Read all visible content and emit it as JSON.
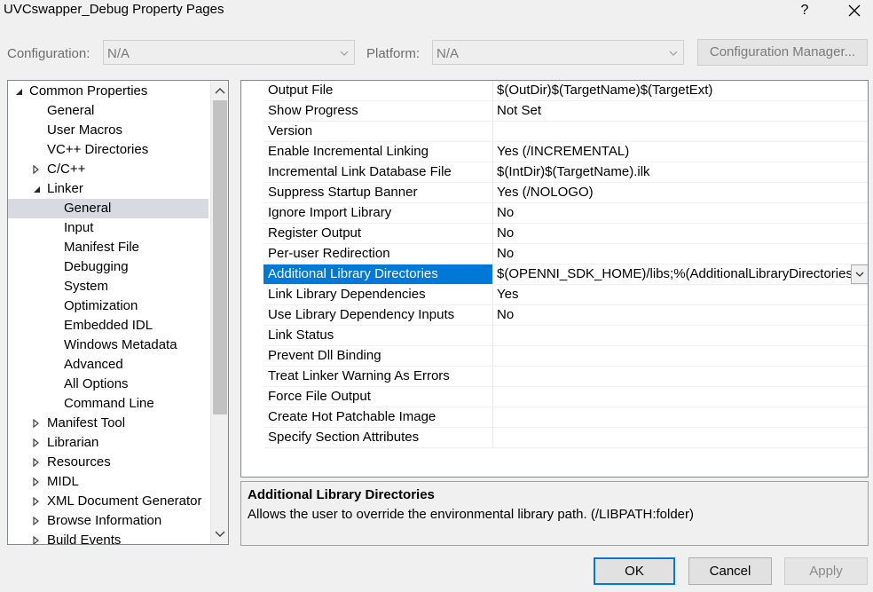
{
  "window": {
    "title": "UVCswapper_Debug Property Pages",
    "help_glyph": "?"
  },
  "config": {
    "configuration_label": "Configuration:",
    "configuration_value": "N/A",
    "platform_label": "Platform:",
    "platform_value": "N/A",
    "manager_button": "Configuration Manager..."
  },
  "tree": {
    "items": [
      {
        "label": "Common Properties"
      },
      {
        "label": "General"
      },
      {
        "label": "User Macros"
      },
      {
        "label": "VC++ Directories"
      },
      {
        "label": "C/C++"
      },
      {
        "label": "Linker"
      },
      {
        "label": "General"
      },
      {
        "label": "Input"
      },
      {
        "label": "Manifest File"
      },
      {
        "label": "Debugging"
      },
      {
        "label": "System"
      },
      {
        "label": "Optimization"
      },
      {
        "label": "Embedded IDL"
      },
      {
        "label": "Windows Metadata"
      },
      {
        "label": "Advanced"
      },
      {
        "label": "All Options"
      },
      {
        "label": "Command Line"
      },
      {
        "label": "Manifest Tool"
      },
      {
        "label": "Librarian"
      },
      {
        "label": "Resources"
      },
      {
        "label": "MIDL"
      },
      {
        "label": "XML Document Generator"
      },
      {
        "label": "Browse Information"
      },
      {
        "label": "Build Events"
      }
    ]
  },
  "grid": {
    "rows": [
      {
        "name": "Output File",
        "value": "$(OutDir)$(TargetName)$(TargetExt)"
      },
      {
        "name": "Show Progress",
        "value": "Not Set"
      },
      {
        "name": "Version",
        "value": ""
      },
      {
        "name": "Enable Incremental Linking",
        "value": "Yes (/INCREMENTAL)"
      },
      {
        "name": "Incremental Link Database File",
        "value": "$(IntDir)$(TargetName).ilk"
      },
      {
        "name": "Suppress Startup Banner",
        "value": "Yes (/NOLOGO)"
      },
      {
        "name": "Ignore Import Library",
        "value": "No"
      },
      {
        "name": "Register Output",
        "value": "No"
      },
      {
        "name": "Per-user Redirection",
        "value": "No"
      },
      {
        "name": "Additional Library Directories",
        "value": "$(OPENNI_SDK_HOME)/libs;%(AdditionalLibraryDirectories)"
      },
      {
        "name": "Link Library Dependencies",
        "value": "Yes"
      },
      {
        "name": "Use Library Dependency Inputs",
        "value": "No"
      },
      {
        "name": "Link Status",
        "value": ""
      },
      {
        "name": "Prevent Dll Binding",
        "value": ""
      },
      {
        "name": "Treat Linker Warning As Errors",
        "value": ""
      },
      {
        "name": "Force File Output",
        "value": ""
      },
      {
        "name": "Create Hot Patchable Image",
        "value": ""
      },
      {
        "name": "Specify Section Attributes",
        "value": ""
      }
    ]
  },
  "description": {
    "title": "Additional Library Directories",
    "text": "Allows the user to override the environmental library path. (/LIBPATH:folder)"
  },
  "buttons": {
    "ok": "OK",
    "cancel": "Cancel",
    "apply": "Apply"
  },
  "colors": {
    "selection": "#0078d7",
    "tree_selection": "#d9d9e2"
  }
}
